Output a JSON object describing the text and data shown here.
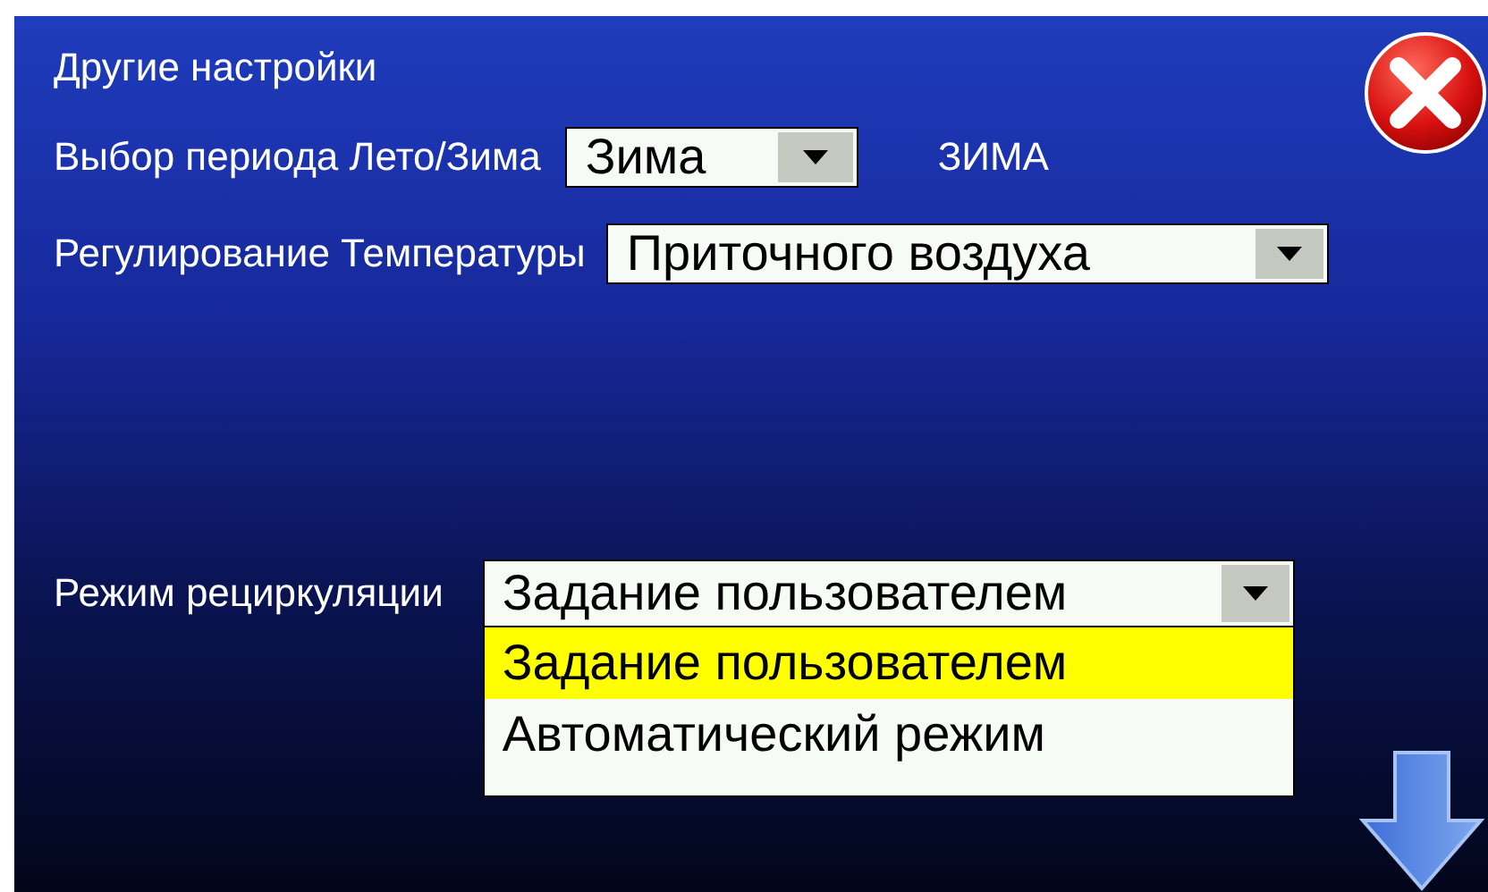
{
  "title": "Другие настройки",
  "season": {
    "label": "Выбор периода Лето/Зима",
    "value": "Зима",
    "status": "ЗИМА"
  },
  "temperature": {
    "label": "Регулирование Температуры",
    "value": "Приточного воздуха"
  },
  "recirculation": {
    "label": "Режим рециркуляции",
    "value": "Задание пользователем",
    "expanded": true,
    "options": [
      {
        "label": "Задание пользователем",
        "selected": true
      },
      {
        "label": "Автоматический режим",
        "selected": false
      }
    ]
  }
}
